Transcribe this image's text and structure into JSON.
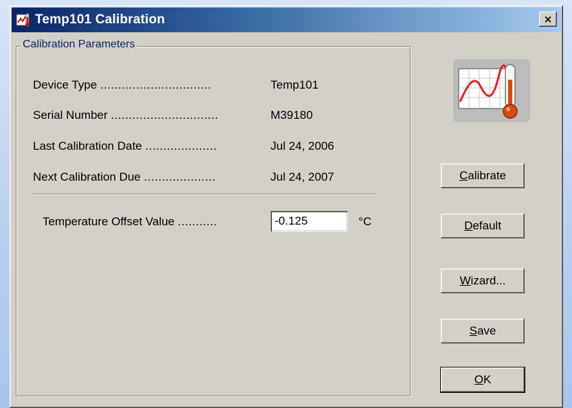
{
  "window": {
    "title": "Temp101 Calibration",
    "close_label": "×"
  },
  "group": {
    "label": "Calibration Parameters"
  },
  "fields": [
    {
      "label": "Device Type",
      "dots": "...............................",
      "value": "Temp101"
    },
    {
      "label": "Serial Number",
      "dots": "..............................",
      "value": "M39180"
    },
    {
      "label": "Last Calibration Date",
      "dots": "....................",
      "value": "Jul 24, 2006"
    },
    {
      "label": "Next Calibration Due",
      "dots": "....................",
      "value": "Jul 24, 2007"
    }
  ],
  "offset": {
    "label": "Temperature Offset Value",
    "dots": "...........",
    "value": "-0.125",
    "unit": "°C"
  },
  "buttons": {
    "calibrate": {
      "accel": "C",
      "rest": "alibrate"
    },
    "default": {
      "accel": "D",
      "rest": "efault"
    },
    "wizard": {
      "accel": "W",
      "rest": "izard..."
    },
    "save": {
      "accel": "S",
      "rest": "ave"
    },
    "ok": {
      "accel": "O",
      "rest": "K"
    }
  },
  "colors": {
    "titlebar_start": "#0a246a",
    "titlebar_end": "#a6caf0",
    "dialog_face": "#d4d0c8",
    "group_label": "#0a246a"
  },
  "icons": {
    "app": "chart-thermometer-icon",
    "logo": "calibration-chart-thermometer-icon",
    "close": "close-icon"
  }
}
